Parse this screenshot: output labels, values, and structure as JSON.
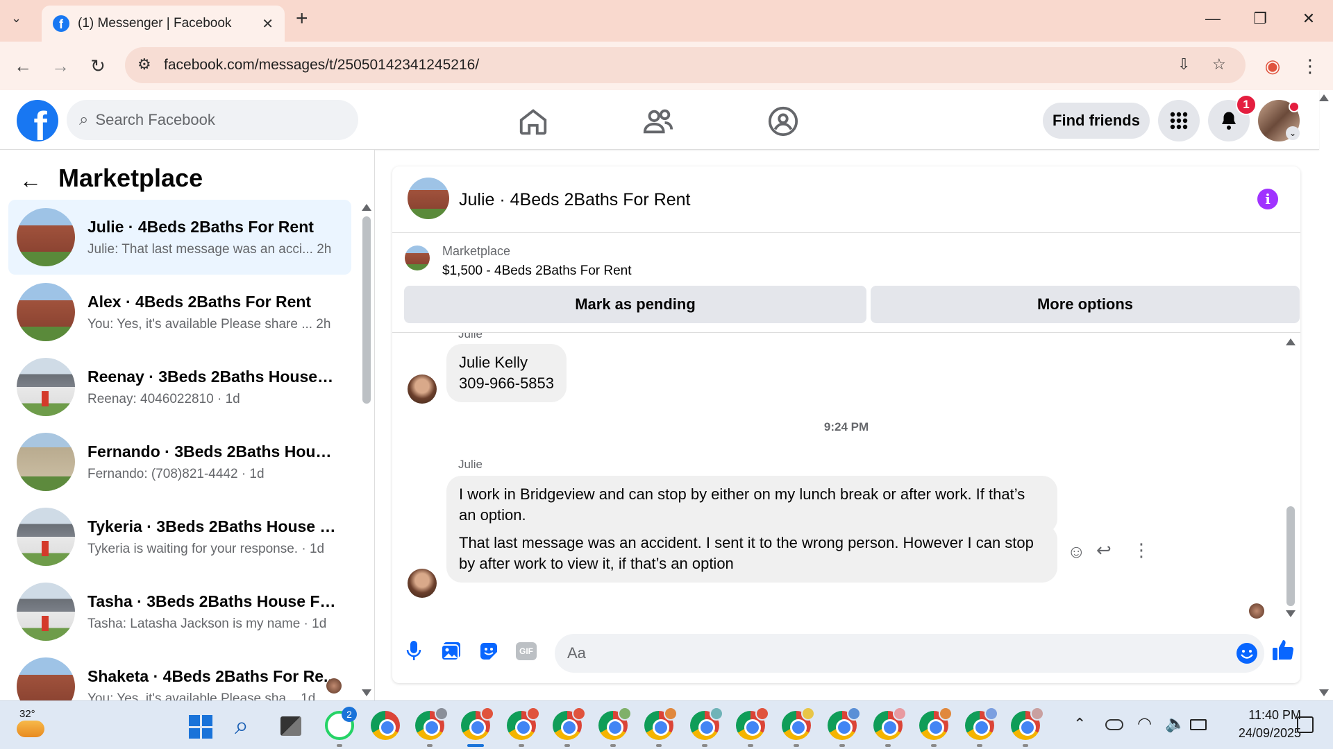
{
  "browser": {
    "tab_title": "(1) Messenger | Facebook",
    "tab_close": "✕",
    "new_tab": "+",
    "url": "facebook.com/messages/t/25050142341245216/",
    "window": {
      "minimize": "—",
      "restore": "❐",
      "close": "✕"
    }
  },
  "fb_header": {
    "logo_letter": "f",
    "search_placeholder": "Search Facebook",
    "find_friends": "Find friends",
    "notification_count": "1"
  },
  "sidebar": {
    "title": "Marketplace",
    "conversations": [
      {
        "name": "Julie · 4Beds 2Baths For Rent",
        "snippet": "Julie: That last message was an acci...  2h",
        "thumb": "brick",
        "selected": true
      },
      {
        "name": "Alex · 4Beds 2Baths For Rent",
        "snippet": "You: Yes, it's available Please share ...  2h",
        "thumb": "brick",
        "selected": false
      },
      {
        "name": "Reenay · 3Beds 2Baths House Fo...",
        "snippet": "Reenay: 4046022810 · 1d",
        "thumb": "gray",
        "selected": false
      },
      {
        "name": "Fernando · 3Beds 2Baths House ...",
        "snippet": "Fernando: (708)821-4442 · 1d",
        "thumb": "beige",
        "selected": false
      },
      {
        "name": "Tykeria · 3Beds 2Baths House Fo...",
        "snippet": "Tykeria is waiting for your response. · 1d",
        "thumb": "gray",
        "selected": false
      },
      {
        "name": "Tasha · 3Beds 2Baths House For ...",
        "snippet": "Tasha: Latasha Jackson is my name · 1d",
        "thumb": "gray",
        "selected": false
      },
      {
        "name": "Shaketa · 4Beds 2Baths For Re...",
        "snippet": "You: Yes, it's available Please sha...  1d",
        "thumb": "brick",
        "selected": false
      }
    ]
  },
  "chat": {
    "title": "Julie · 4Beds 2Baths For Rent",
    "info_glyph": "i",
    "listing": {
      "label": "Marketplace",
      "price_title": "$1,500 - 4Beds 2Baths For Rent",
      "mark_pending": "Mark as pending",
      "more_options": "More options"
    },
    "messages": {
      "sender_top": "Julie",
      "contact_line1": "Julie Kelly",
      "contact_line2": "309-966-5853",
      "timestamp": "9:24 PM",
      "sender": "Julie",
      "msg1": "I work in Bridgeview and can stop by either on my lunch break or after work. If that’s an option.",
      "msg2": "That last message was an accident. I sent it to the wrong person. However I can stop by after work to view it, if that’s an option"
    },
    "composer_placeholder": "Aa",
    "like_glyph": "👍"
  },
  "taskbar": {
    "weather": "32°",
    "whatsapp_badge": "2",
    "time": "11:40 PM",
    "date": "24/09/2025",
    "profile_colors": [
      "#8a8f99",
      "#e0533d",
      "#e0533d",
      "#e0533d",
      "#7fb069",
      "#e0883d",
      "#6fb3b8",
      "#e0533d",
      "#e8c547",
      "#5a8fd6",
      "#e89aa0",
      "#e0883d",
      "#7b9fe0",
      "#c9a0a0"
    ]
  },
  "colors": {
    "fb_blue": "#1877f2",
    "messenger_blue": "#0866ff",
    "badge_red": "#e41e3f",
    "info_purple": "#a033ff"
  }
}
